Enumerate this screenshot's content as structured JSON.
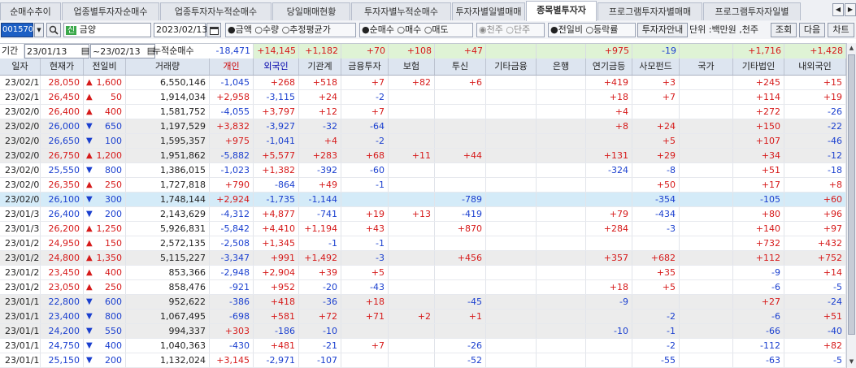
{
  "tabs": [
    "순매수추이",
    "업종별투자자순매수",
    "업종투자자누적순매수",
    "당일매매현황",
    "투자자별누적순매수",
    "투자자별일별매매",
    "종목별투자자",
    "프로그램투자자별매매",
    "프로그램투자자일별"
  ],
  "active_tab": 6,
  "toolbar": {
    "code": "001570",
    "stock_badge": "신",
    "stock_name": "금양",
    "date": "2023/02/13",
    "radio1": [
      "●금액",
      "○수량",
      "○추정평균가"
    ],
    "radio2": [
      "●순매수",
      "○매수",
      "○매도"
    ],
    "radio3": [
      "◉천주",
      "○단주"
    ],
    "radio4": [
      "●전일비",
      "○등락률"
    ],
    "investor_info_button": "투자자안내",
    "unit_label": "단위 :백만원 ,천주",
    "query_button": "조회",
    "next_button": "다음",
    "chart_button": "차트"
  },
  "period": {
    "label": "기간",
    "from": "23/01/13",
    "tilde": "~",
    "to": "23/02/13",
    "cumulative_label": "누적순매수",
    "values": [
      "-18,471",
      "+14,145",
      "+1,182",
      "+70",
      "+108",
      "+47",
      "",
      "",
      "+975",
      "-19",
      "",
      "+1,716",
      "+1,428"
    ]
  },
  "headers": [
    "일자",
    "현재가",
    "전일비",
    "거래량",
    "개인",
    "외국인",
    "기관계",
    "금융투자",
    "보험",
    "투신",
    "기타금융",
    "은행",
    "연기금등",
    "사모펀드",
    "국가",
    "기타법인",
    "내외국인"
  ],
  "rows": [
    {
      "date": "23/02/13",
      "price": "28,050",
      "dir": "up",
      "chg": "1,600",
      "vol": "6,550,146",
      "v": [
        "-1,045",
        "+268",
        "+518",
        "+7",
        "+82",
        "+6",
        "",
        "",
        "+419",
        "+3",
        "",
        "+245",
        "+15"
      ]
    },
    {
      "date": "23/02/10",
      "price": "26,450",
      "dir": "up",
      "chg": "50",
      "vol": "1,914,034",
      "v": [
        "+2,958",
        "-3,115",
        "+24",
        "-2",
        "",
        "",
        "",
        "",
        "+18",
        "+7",
        "",
        "+114",
        "+19"
      ]
    },
    {
      "date": "23/02/09",
      "price": "26,400",
      "dir": "up",
      "chg": "400",
      "vol": "1,581,752",
      "v": [
        "-4,055",
        "+3,797",
        "+12",
        "+7",
        "",
        "",
        "",
        "",
        "+4",
        "",
        "",
        "+272",
        "-26"
      ]
    },
    {
      "date": "23/02/08",
      "price": "26,000",
      "dir": "dn",
      "chg": "650",
      "vol": "1,197,529",
      "v": [
        "+3,832",
        "-3,927",
        "-32",
        "-64",
        "",
        "",
        "",
        "",
        "+8",
        "+24",
        "",
        "+150",
        "-22"
      ]
    },
    {
      "date": "23/02/07",
      "price": "26,650",
      "dir": "dn",
      "chg": "100",
      "vol": "1,595,357",
      "v": [
        "+975",
        "-1,041",
        "+4",
        "-2",
        "",
        "",
        "",
        "",
        "",
        "+5",
        "",
        "+107",
        "-46"
      ]
    },
    {
      "date": "23/02/06",
      "price": "26,750",
      "dir": "up",
      "chg": "1,200",
      "vol": "1,951,862",
      "v": [
        "-5,882",
        "+5,577",
        "+283",
        "+68",
        "+11",
        "+44",
        "",
        "",
        "+131",
        "+29",
        "",
        "+34",
        "-12"
      ]
    },
    {
      "date": "23/02/03",
      "price": "25,550",
      "dir": "dn",
      "chg": "800",
      "vol": "1,386,015",
      "v": [
        "-1,023",
        "+1,382",
        "-392",
        "-60",
        "",
        "",
        "",
        "",
        "-324",
        "-8",
        "",
        "+51",
        "-18"
      ]
    },
    {
      "date": "23/02/02",
      "price": "26,350",
      "dir": "up",
      "chg": "250",
      "vol": "1,727,818",
      "v": [
        "+790",
        "-864",
        "+49",
        "-1",
        "",
        "",
        "",
        "",
        "",
        "+50",
        "",
        "+17",
        "+8"
      ]
    },
    {
      "date": "23/02/01",
      "price": "26,100",
      "dir": "dn",
      "chg": "300",
      "vol": "1,748,144",
      "v": [
        "+2,924",
        "-1,735",
        "-1,144",
        "",
        "",
        "-789",
        "",
        "",
        "",
        "-354",
        "",
        "-105",
        "+60"
      ]
    },
    {
      "date": "23/01/31",
      "price": "26,400",
      "dir": "dn",
      "chg": "200",
      "vol": "2,143,629",
      "v": [
        "-4,312",
        "+4,877",
        "-741",
        "+19",
        "+13",
        "-419",
        "",
        "",
        "+79",
        "-434",
        "",
        "+80",
        "+96"
      ]
    },
    {
      "date": "23/01/30",
      "price": "26,200",
      "dir": "up",
      "chg": "1,250",
      "vol": "5,926,831",
      "v": [
        "-5,842",
        "+4,410",
        "+1,194",
        "+43",
        "",
        "+870",
        "",
        "",
        "+284",
        "-3",
        "",
        "+140",
        "+97"
      ]
    },
    {
      "date": "23/01/27",
      "price": "24,950",
      "dir": "up",
      "chg": "150",
      "vol": "2,572,135",
      "v": [
        "-2,508",
        "+1,345",
        "-1",
        "-1",
        "",
        "",
        "",
        "",
        "",
        "",
        "",
        "+732",
        "+432"
      ]
    },
    {
      "date": "23/01/26",
      "price": "24,800",
      "dir": "up",
      "chg": "1,350",
      "vol": "5,115,227",
      "v": [
        "-3,347",
        "+991",
        "+1,492",
        "-3",
        "",
        "+456",
        "",
        "",
        "+357",
        "+682",
        "",
        "+112",
        "+752"
      ]
    },
    {
      "date": "23/01/25",
      "price": "23,450",
      "dir": "up",
      "chg": "400",
      "vol": "853,366",
      "v": [
        "-2,948",
        "+2,904",
        "+39",
        "+5",
        "",
        "",
        "",
        "",
        "",
        "+35",
        "",
        "-9",
        "+14"
      ]
    },
    {
      "date": "23/01/20",
      "price": "23,050",
      "dir": "up",
      "chg": "250",
      "vol": "858,476",
      "v": [
        "-921",
        "+952",
        "-20",
        "-43",
        "",
        "",
        "",
        "",
        "+18",
        "+5",
        "",
        "-6",
        "-5"
      ]
    },
    {
      "date": "23/01/19",
      "price": "22,800",
      "dir": "dn",
      "chg": "600",
      "vol": "952,622",
      "v": [
        "-386",
        "+418",
        "-36",
        "+18",
        "",
        "-45",
        "",
        "",
        "-9",
        "",
        "",
        "+27",
        "-24"
      ]
    },
    {
      "date": "23/01/18",
      "price": "23,400",
      "dir": "dn",
      "chg": "800",
      "vol": "1,067,495",
      "v": [
        "-698",
        "+581",
        "+72",
        "+71",
        "+2",
        "+1",
        "",
        "",
        "",
        "-2",
        "",
        "-6",
        "+51"
      ]
    },
    {
      "date": "23/01/17",
      "price": "24,200",
      "dir": "dn",
      "chg": "550",
      "vol": "994,337",
      "v": [
        "+303",
        "-186",
        "-10",
        "",
        "",
        "",
        "",
        "",
        "-10",
        "-1",
        "",
        "-66",
        "-40"
      ]
    },
    {
      "date": "23/01/16",
      "price": "24,750",
      "dir": "dn",
      "chg": "400",
      "vol": "1,040,363",
      "v": [
        "-430",
        "+481",
        "-21",
        "+7",
        "",
        "-26",
        "",
        "",
        "",
        "-2",
        "",
        "-112",
        "+82"
      ]
    },
    {
      "date": "23/01/13",
      "price": "25,150",
      "dir": "dn",
      "chg": "200",
      "vol": "1,132,024",
      "v": [
        "+3,145",
        "-2,971",
        "-107",
        "",
        "",
        "-52",
        "",
        "",
        "",
        "-55",
        "",
        "-63",
        "-5"
      ]
    }
  ],
  "row_shading": [
    "",
    "",
    "",
    "gray",
    "gray",
    "gray",
    "",
    "",
    "sel",
    "",
    "",
    "",
    "gray",
    "",
    "",
    "gray",
    "gray",
    "gray",
    "",
    ""
  ],
  "colors": {
    "up": "#d61a1a",
    "down": "#1a3fcf",
    "header_bg": "#dde5f0",
    "selected_row": "#d4ebf8"
  }
}
